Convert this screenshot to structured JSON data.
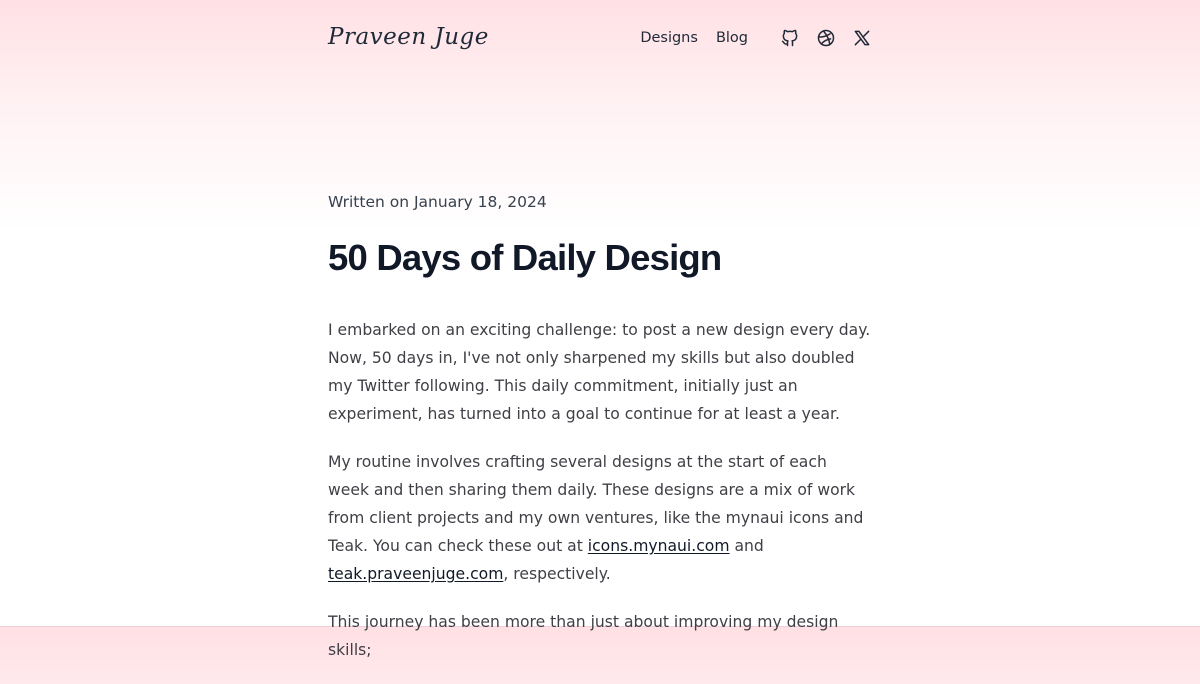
{
  "header": {
    "logo": "Praveen Juge",
    "nav": {
      "designs": "Designs",
      "blog": "Blog"
    },
    "social_icons": [
      "github-icon",
      "dribbble-icon",
      "x-icon"
    ]
  },
  "article": {
    "date": "Written on January 18, 2024",
    "title": "50 Days of Daily Design",
    "p1": "I embarked on an exciting challenge: to post a new design every day. Now, 50 days in, I've not only sharpened my skills but also doubled my Twitter following. This daily commitment, initially just an experiment, has turned into a goal to continue for at least a year.",
    "p2": {
      "before": "My routine involves crafting several designs at the start of each week and then sharing them daily. These designs are a mix of work from client projects and my own ventures, like the mynaui icons and Teak. You can check these out at ",
      "link1": "icons.mynaui.com",
      "between": " and ",
      "link2": "teak.praveenjuge.com",
      "after": ", respectively."
    },
    "p3": "This journey has been more than just about improving my design skills;"
  },
  "colors": {
    "title": "#111827",
    "body_text": "#3f3f46",
    "header_gradient_top": "#ffe0e4"
  }
}
